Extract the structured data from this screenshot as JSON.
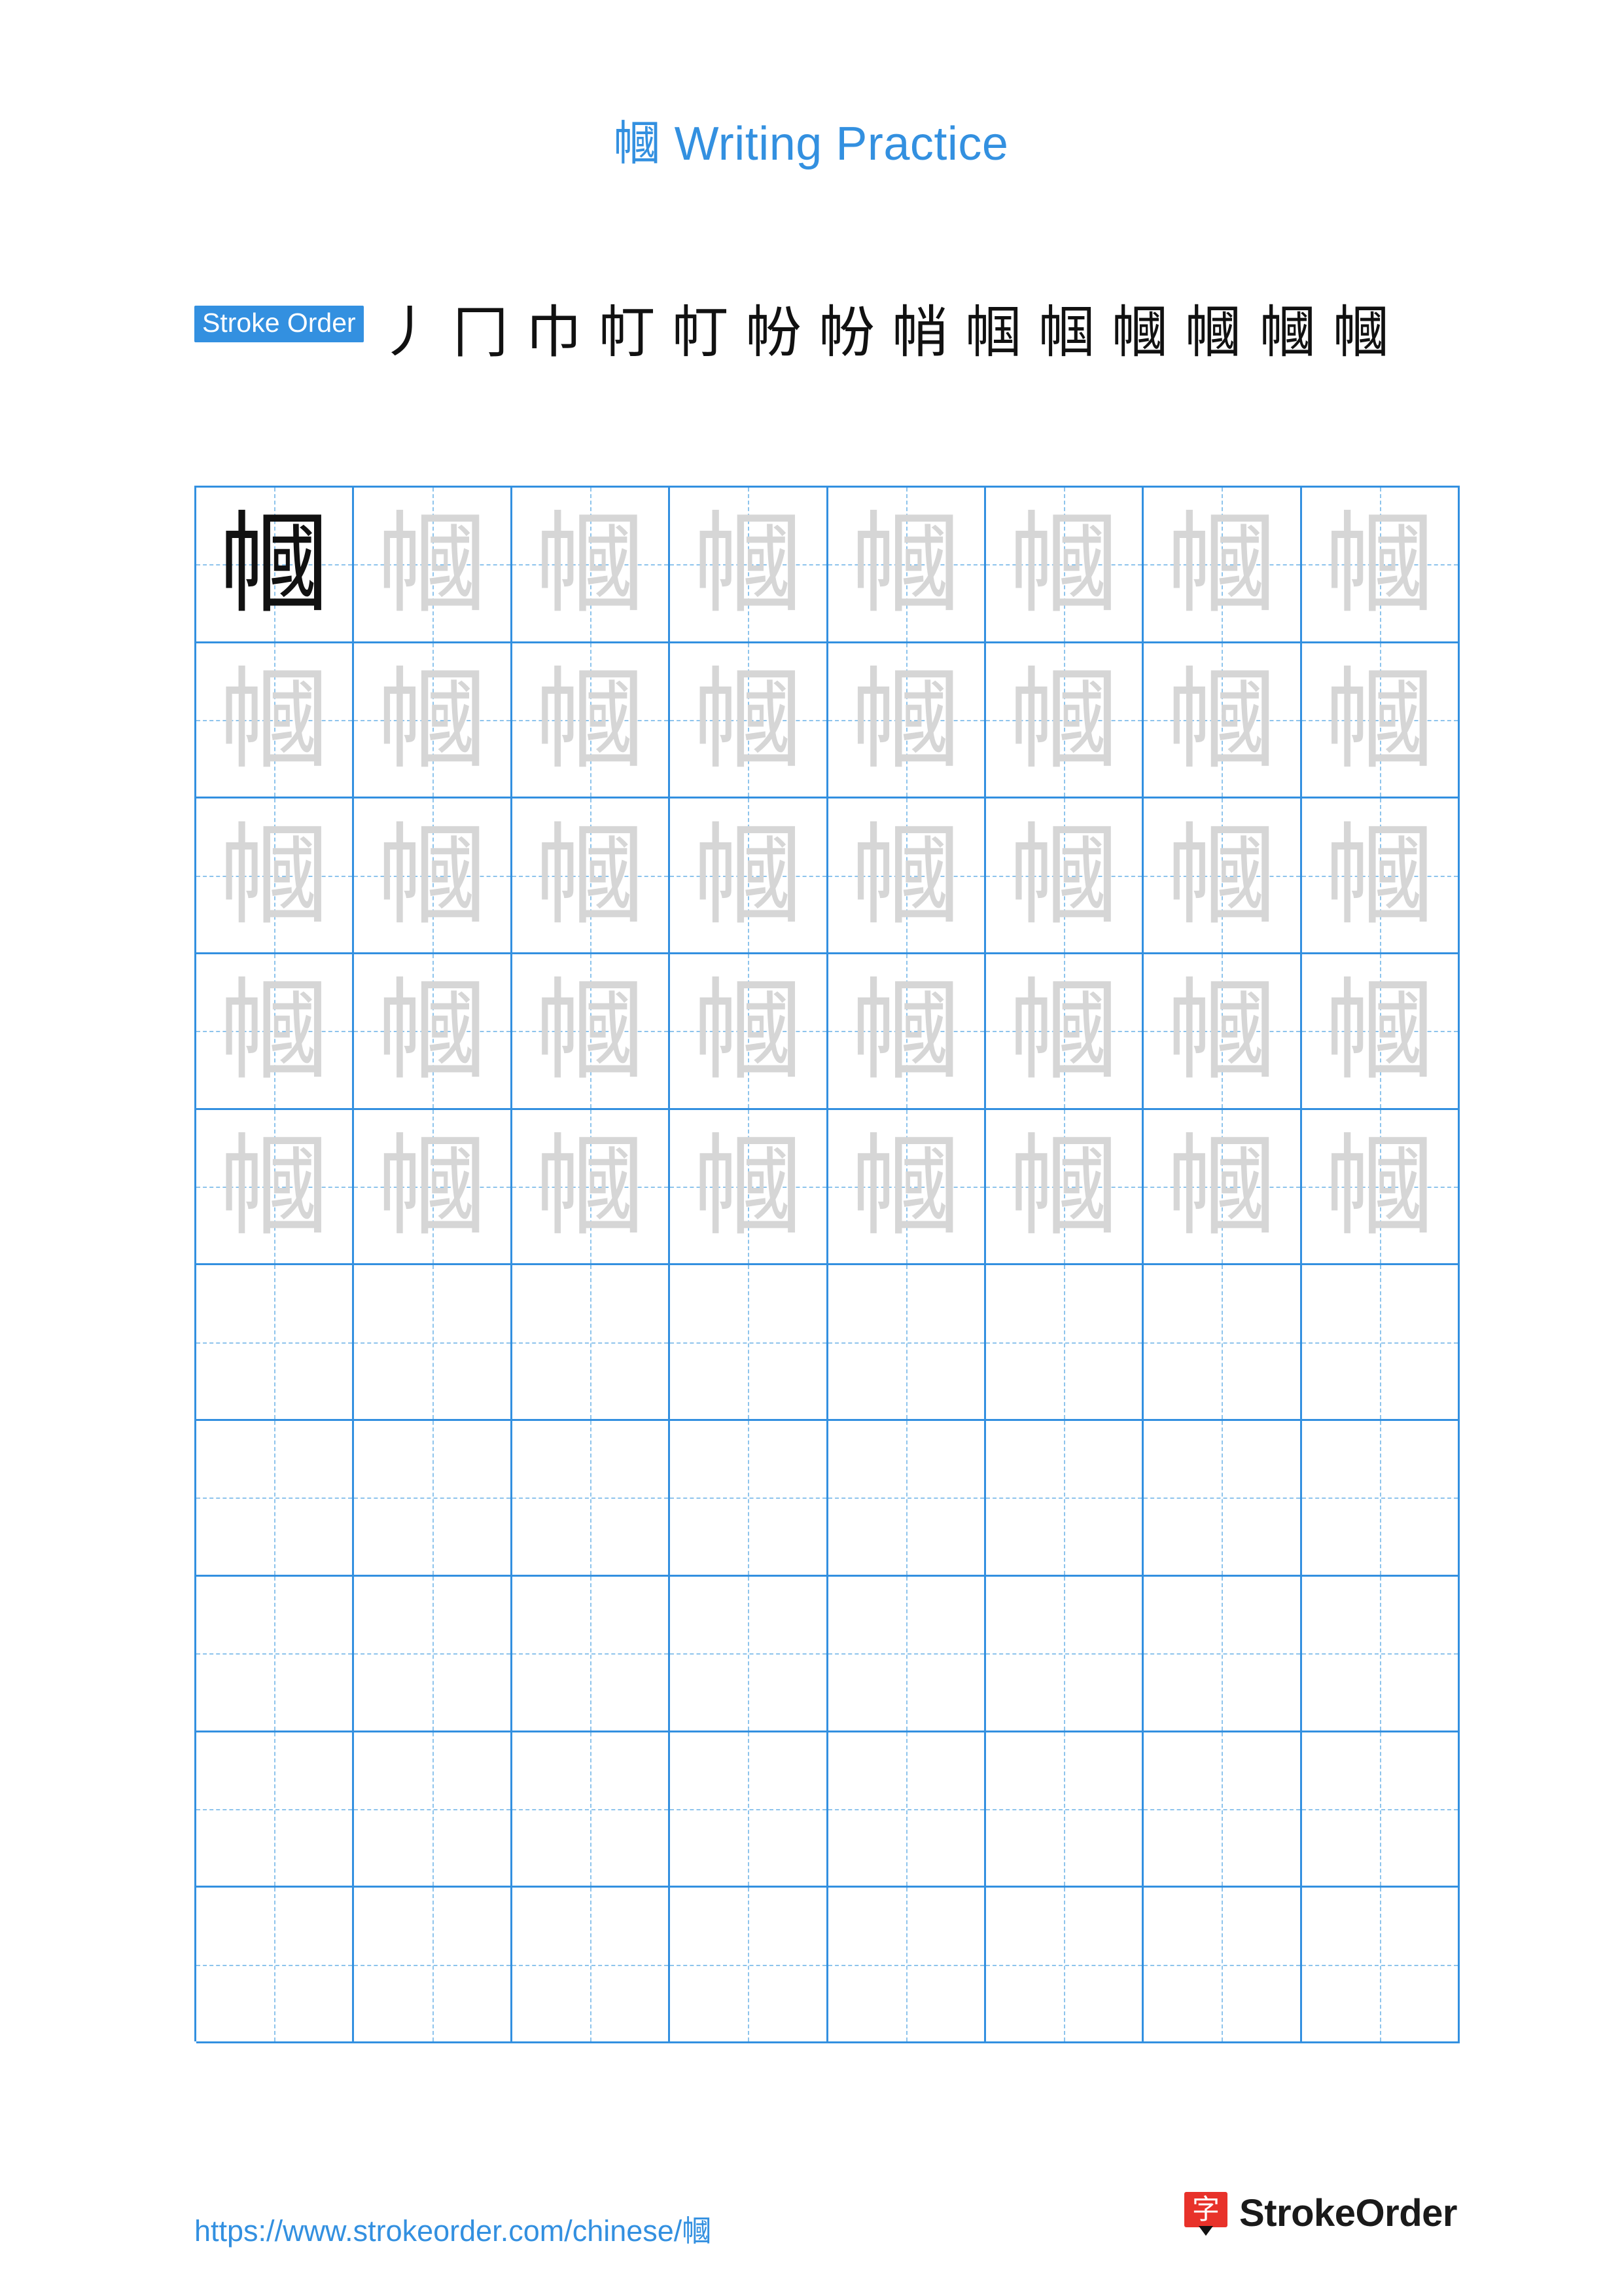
{
  "page": {
    "character": "幗",
    "title_suffix": " Writing Practice"
  },
  "stroke_order": {
    "label": "Stroke Order",
    "steps_row1": [
      "丿",
      "冂",
      "巾",
      "帄",
      "帄",
      "帉",
      "帉",
      "帩",
      "帼",
      "帼",
      "幗",
      "幗"
    ],
    "steps_row2": [
      "幗",
      "幗"
    ],
    "total_strokes": 14
  },
  "practice_grid": {
    "columns": 8,
    "rows": 10,
    "model_char": "幗",
    "ghost_char": "幗",
    "filled_rows": 5,
    "blank_rows": 5
  },
  "footer": {
    "url": "https://www.strokeorder.com/chinese/幗",
    "brand_glyph": "字",
    "brand_name": "StrokeOrder"
  }
}
